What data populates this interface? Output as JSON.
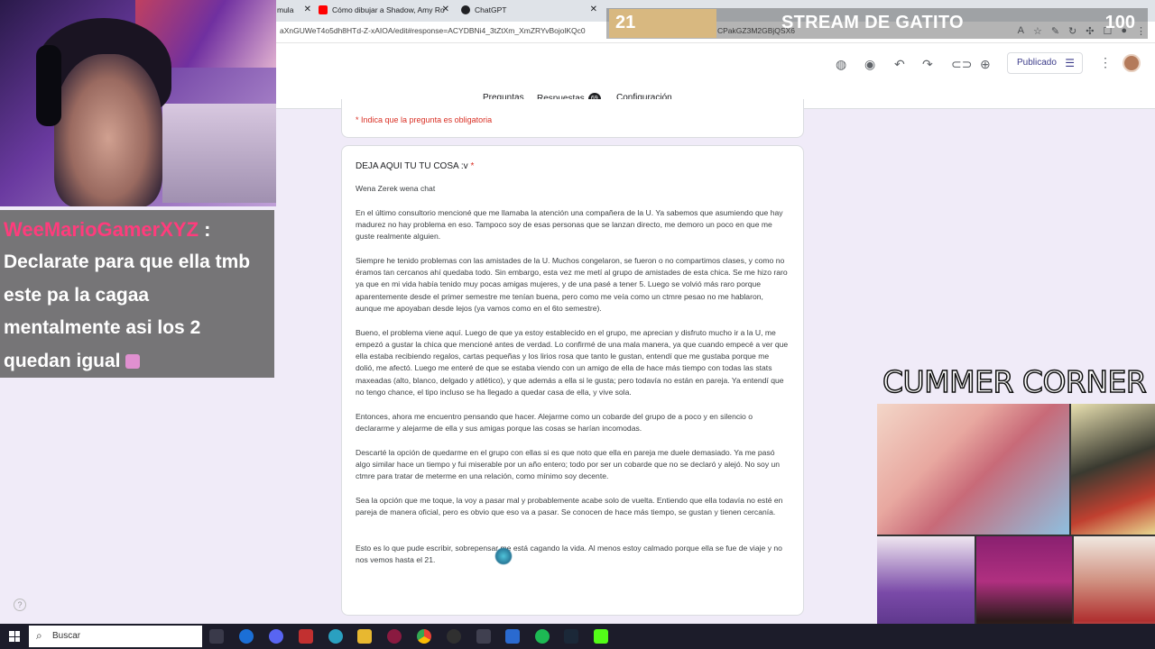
{
  "browser": {
    "tabs": [
      {
        "label": "mula",
        "icon_color": "#7b5cc7"
      },
      {
        "label": "Cómo dibujar a Shadow, Amy Ro",
        "icon_color": "#ff0000"
      },
      {
        "label": "ChatGPT",
        "icon_color": "#202124"
      }
    ],
    "url": "aXnGUWeT4o5dh8HTd-Z-xAIOA/edit#response=ACYDBNi4_3tZtXm_XmZRYvBojolKQc0",
    "url_tail": "CPakGZ3M2GBjQSX6"
  },
  "forms": {
    "publish_label": "Publicado",
    "tabs": {
      "questions": "Preguntas",
      "responses": "Respuestas",
      "responses_count": "69",
      "settings": "Configuración"
    },
    "required_note": "* Indica que la pregunta es obligatoria",
    "question_title": "DEJA AQUI TU TU COSA :v",
    "required_mark": "*",
    "answer_paragraphs": [
      "Wena Zerek wena chat",
      "En el último consultorio mencioné que me llamaba la atención una compañera de la U. Ya sabemos que asumiendo que hay madurez no hay problema en eso. Tampoco soy de esas personas que se lanzan directo, me demoro un poco en que me guste realmente alguien.",
      "Siempre he tenido problemas con las amistades de la U. Muchos congelaron, se fueron o no compartimos clases, y como no éramos tan cercanos ahí quedaba todo. Sin embargo, esta vez me metí al grupo de amistades de esta chica. Se me hizo raro ya que en mi vida había tenido muy pocas amigas mujeres, y de una pasé a tener 5. Luego se volvió más raro porque aparentemente desde el primer semestre me tenían buena, pero como me veía como un ctmre pesao no me hablaron, aunque me apoyaban desde lejos (ya vamos como en el 6to semestre).",
      "Bueno, el problema viene aquí. Luego de que ya estoy establecido en el grupo, me aprecian y disfruto mucho ir a la U, me empezó a gustar la chica que mencioné antes de verdad. Lo confirmé de una mala manera, ya que cuando empecé a ver que ella estaba recibiendo regalos, cartas pequeñas y los lirios rosa que tanto le gustan, entendí que me gustaba porque me dolió, me afectó. Luego me enteré de que se estaba viendo con un amigo de ella de hace más tiempo con todas las stats maxeadas (alto, blanco, delgado y atlético), y que además a ella si le gusta; pero todavía no están en pareja. Ya entendí que no tengo chance, el tipo incluso se ha llegado a quedar casa de ella, y vive sola.",
      "Entonces, ahora me encuentro pensando que hacer. Alejarme como un cobarde del grupo de a poco y en silencio o declararme y alejarme de ella y sus amigas porque las cosas se harían incomodas.",
      "Descarté la opción de quedarme en el grupo con ellas si es que noto que ella en pareja me duele demasiado. Ya me pasó algo similar hace un tiempo y fui miserable por un año entero; todo por ser un cobarde que no se declaró y alejó. No soy un ctmre para tratar de meterme en una relación, como mínimo soy decente.",
      "Sea la opción que me toque, la voy a pasar mal y probablemente acabe solo de vuelta. Entiendo que ella todavía no esté en pareja de manera oficial, pero es obvio que eso va a pasar. Se conocen de hace más tiempo, se gustan y tienen cercanía.",
      "Esto es lo que pude escribir, sobrepensar me está cagando la vida. Al menos estoy calmado porque ella se fue de viaje y no nos vemos hasta el 21."
    ]
  },
  "stream": {
    "counter_left": "21",
    "title": "STREAM DE GATITO",
    "counter_right": "100",
    "chat_user": "WeeMarioGamerXYZ",
    "chat_colon": ":",
    "chat_lines": [
      "Declarate para que ella tmb",
      "este pa la cagaa",
      "mentalmente asi los 2",
      "quedan igual"
    ],
    "corner_title": "CUMMER CORNER"
  },
  "taskbar": {
    "search_placeholder": "Buscar"
  },
  "colors": {
    "forms_accent": "#673ab7",
    "required_red": "#d93025",
    "chat_user": "#ff3c7c"
  }
}
